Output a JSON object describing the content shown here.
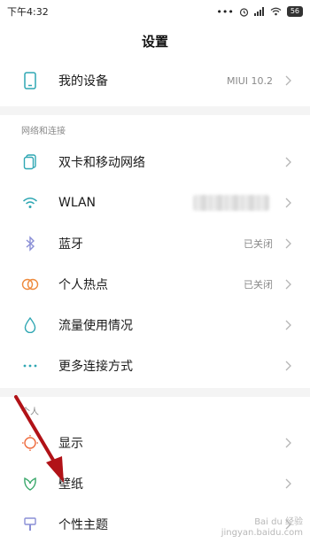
{
  "status_bar": {
    "time": "下午4:32",
    "battery": "56"
  },
  "header": {
    "title": "设置"
  },
  "device": {
    "label": "我的设备",
    "value": "MIUI 10.2"
  },
  "network_section": {
    "title": "网络和连接",
    "items": [
      {
        "label": "双卡和移动网络",
        "value": ""
      },
      {
        "label": "WLAN",
        "value": ""
      },
      {
        "label": "蓝牙",
        "value": "已关闭"
      },
      {
        "label": "个人热点",
        "value": "已关闭"
      },
      {
        "label": "流量使用情况",
        "value": ""
      },
      {
        "label": "更多连接方式",
        "value": ""
      }
    ]
  },
  "personal_section": {
    "title": "个人",
    "items": [
      {
        "label": "显示"
      },
      {
        "label": "壁纸"
      },
      {
        "label": "个性主题"
      }
    ]
  },
  "watermark": {
    "line1": "Bai du 经验",
    "line2": "jingyan.baidu.com"
  },
  "colors": {
    "accent_teal": "#2fa7b3",
    "arrow_red": "#b11217",
    "text_secondary": "#8a8a8a"
  }
}
